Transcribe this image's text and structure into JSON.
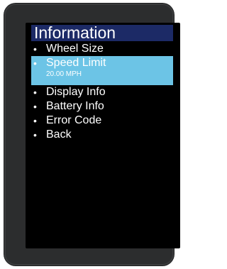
{
  "screen": {
    "title": "Information",
    "menu": [
      {
        "label": "Wheel Size",
        "selected": false
      },
      {
        "label": "Speed Limit",
        "value": "20.00 MPH",
        "selected": true
      },
      {
        "label": "Display Info",
        "selected": false
      },
      {
        "label": "Battery Info",
        "selected": false
      },
      {
        "label": "Error Code",
        "selected": false
      },
      {
        "label": "Back",
        "selected": false
      }
    ],
    "bullet": "•"
  },
  "colors": {
    "title_bar": "#1c2a66",
    "selection": "#6cc4e6",
    "screen_bg": "#000000",
    "text": "#ffffff"
  }
}
